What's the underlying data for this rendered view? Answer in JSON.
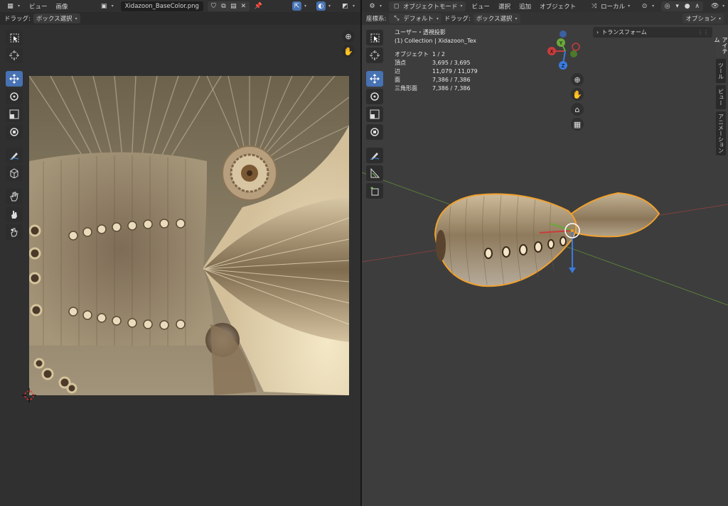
{
  "uv_editor": {
    "header": {
      "menus": [
        "ビュー",
        "画像"
      ],
      "filename": "Xidazoon_BaseColor.png"
    },
    "tool_settings": {
      "drag_label": "ドラッグ:",
      "drag_value": "ボックス選択"
    }
  },
  "viewport": {
    "header": {
      "mode": "オブジェクトモード",
      "menus": [
        "ビュー",
        "選択",
        "追加",
        "オブジェクト"
      ],
      "pivot": "ローカル"
    },
    "tool_settings": {
      "orientation_label": "座標系:",
      "orientation_value": "デフォルト",
      "drag_label": "ドラッグ:",
      "drag_value": "ボックス選択",
      "options": "オプション"
    },
    "overlay": {
      "view_name": "ユーザー・透視投影",
      "collection": "(1) Collection | Xidazoon_Tex",
      "stats": [
        {
          "key": "オブジェクト",
          "value": "1 / 2"
        },
        {
          "key": "頂点",
          "value": "3,695 / 3,695"
        },
        {
          "key": "辺",
          "value": "11,079 / 11,079"
        },
        {
          "key": "面",
          "value": "7,386 / 7,386"
        },
        {
          "key": "三角形面",
          "value": "7,386 / 7,386"
        }
      ]
    },
    "n_panel": {
      "section": "トランスフォーム",
      "tabs": [
        "アイテム",
        "ツール",
        "ビュー",
        "アニメーション"
      ]
    },
    "gizmo": {
      "x": "X",
      "y": "Y",
      "z": "Z"
    }
  },
  "colors": {
    "accent": "#4772b3",
    "selection_outline": "#f0a030",
    "axis_x": "#c83c3c",
    "axis_y": "#6aa83a",
    "axis_z": "#3a7be0"
  }
}
